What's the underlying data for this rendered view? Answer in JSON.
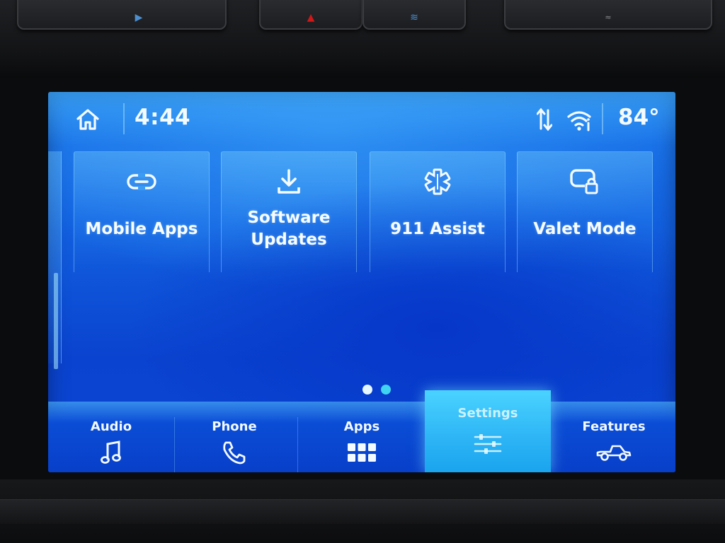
{
  "status_bar": {
    "time": "4:44",
    "temperature": "84°",
    "icons": [
      "home-icon",
      "data-transfer-icon",
      "wifi-icon"
    ]
  },
  "tiles": [
    {
      "label": "Mobile Apps",
      "icon": "link-icon"
    },
    {
      "label": "Software\nUpdates",
      "icon": "download-icon"
    },
    {
      "label": "911 Assist",
      "icon": "star-of-life-icon"
    },
    {
      "label": "Valet Mode",
      "icon": "valet-lock-icon"
    }
  ],
  "pagination": {
    "total": 2,
    "current": 2
  },
  "nav": [
    {
      "label": "Audio",
      "icon": "music-note-icon"
    },
    {
      "label": "Phone",
      "icon": "phone-icon"
    },
    {
      "label": "Apps",
      "icon": "grid-icon"
    },
    {
      "label": "Settings",
      "icon": "sliders-icon",
      "selected": true
    },
    {
      "label": "Features",
      "icon": "pickup-truck-icon"
    }
  ],
  "colors": {
    "screen_blue": "#1260e0",
    "selected_tab": "#2fb6f6",
    "active_dot": "#3fd4f2",
    "text": "#f4fbff"
  }
}
